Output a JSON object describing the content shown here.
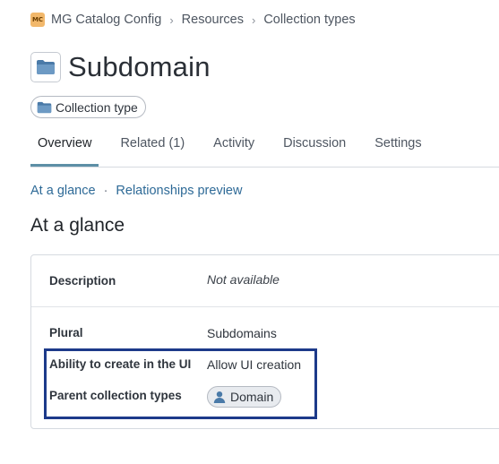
{
  "breadcrumb": {
    "logo_text": "MC",
    "items": [
      "MG Catalog Config",
      "Resources",
      "Collection types"
    ]
  },
  "page": {
    "title": "Subdomain",
    "type_pill": "Collection type"
  },
  "tabs": [
    "Overview",
    "Related (1)",
    "Activity",
    "Discussion",
    "Settings"
  ],
  "anchors": [
    "At a glance",
    "Relationships preview"
  ],
  "section": {
    "heading": "At a glance"
  },
  "fields": {
    "description": {
      "label": "Description",
      "value": "Not available"
    },
    "plural": {
      "label": "Plural",
      "value": "Subdomains"
    },
    "ui_creation": {
      "label": "Ability to create in the UI",
      "value": "Allow UI creation"
    },
    "parent": {
      "label": "Parent collection types",
      "value": "Domain"
    }
  },
  "colors": {
    "accent_tab": "#5d8fa6",
    "link": "#2e6a97",
    "highlight_box": "#1d3a8a",
    "folder_icon": "#4a7aa8"
  }
}
